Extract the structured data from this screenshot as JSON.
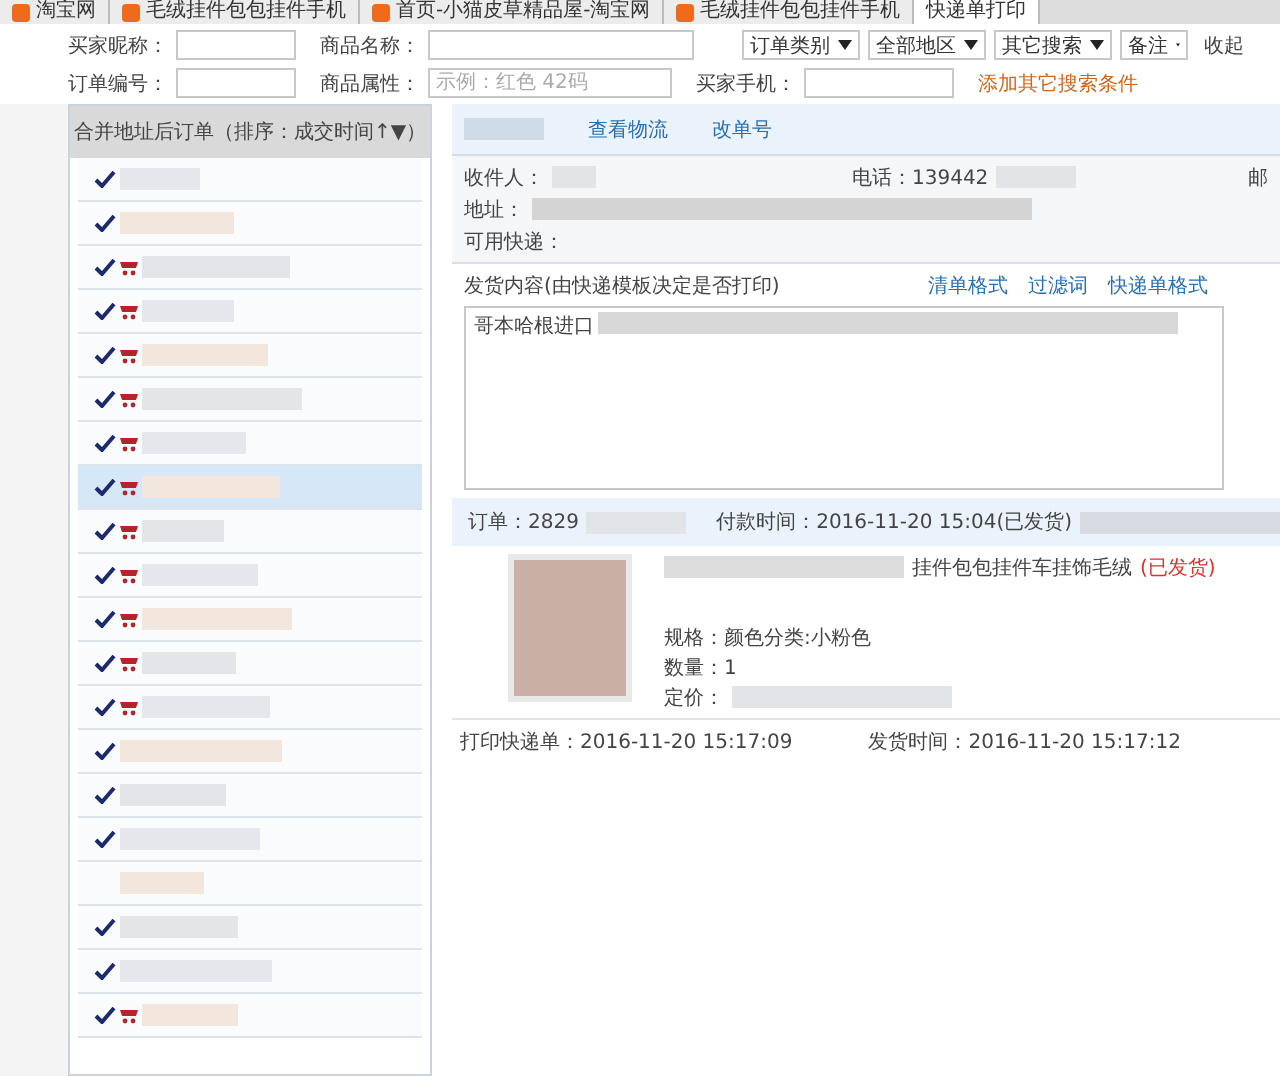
{
  "browser_tabs": [
    {
      "title": "淘宝网",
      "selected": false
    },
    {
      "title": "毛绒挂件包包挂件手机",
      "selected": false
    },
    {
      "title": "首页-小猫皮草精品屋-淘宝网",
      "selected": false
    },
    {
      "title": "毛绒挂件包包挂件手机",
      "selected": false
    },
    {
      "title": "快递单打印",
      "selected": true
    }
  ],
  "search": {
    "row1": [
      {
        "label": "买家昵称："
      },
      {
        "label": "商品名称："
      }
    ],
    "dropdowns": [
      "订单类别",
      "全部地区",
      "其它搜索",
      "备注"
    ],
    "collapse": "收起",
    "row2": [
      {
        "label": "订单编号："
      },
      {
        "label": "商品属性：",
        "placeholder": "示例：红色 42码"
      },
      {
        "label": "买家手机："
      }
    ],
    "more_link": "添加其它搜索条件"
  },
  "order_list": {
    "header": "合并地址后订单（排序：成交时间↑▼）",
    "rows": [
      {
        "checked": true,
        "cart": false,
        "selected": false
      },
      {
        "checked": true,
        "cart": false,
        "selected": false
      },
      {
        "checked": true,
        "cart": true,
        "selected": false
      },
      {
        "checked": true,
        "cart": true,
        "selected": false
      },
      {
        "checked": true,
        "cart": true,
        "selected": false
      },
      {
        "checked": true,
        "cart": true,
        "selected": false
      },
      {
        "checked": true,
        "cart": true,
        "selected": false
      },
      {
        "checked": true,
        "cart": true,
        "selected": true
      },
      {
        "checked": true,
        "cart": true,
        "selected": false
      },
      {
        "checked": true,
        "cart": true,
        "selected": false
      },
      {
        "checked": true,
        "cart": true,
        "selected": false
      },
      {
        "checked": true,
        "cart": true,
        "selected": false
      },
      {
        "checked": true,
        "cart": true,
        "selected": false
      },
      {
        "checked": true,
        "cart": false,
        "selected": false
      },
      {
        "checked": true,
        "cart": false,
        "selected": false
      },
      {
        "checked": true,
        "cart": false,
        "selected": false
      },
      {
        "checked": false,
        "cart": false,
        "selected": false
      },
      {
        "checked": true,
        "cart": false,
        "selected": false
      },
      {
        "checked": true,
        "cart": false,
        "selected": false
      },
      {
        "checked": true,
        "cart": true,
        "selected": false
      }
    ]
  },
  "detail": {
    "actions": [
      "查看物流",
      "改单号"
    ],
    "recipient_label": "收件人：",
    "phone": "电话：139442",
    "column_3": "邮",
    "address_label": "地址：",
    "courier_label": "可用快递：",
    "content_label": "发货内容(由快递模板决定是否打印)",
    "content_links": [
      "清单格式",
      "过滤词",
      "快递单格式"
    ],
    "content_value": "哥本哈根进口",
    "order_no": "订单：2829",
    "paid_time": "付款时间：2016-11-20 15:04(已发货)",
    "product_title": "挂件包包挂件车挂饰毛绒",
    "product_status": "(已发货)",
    "specs": [
      "规格：颜色分类:小粉色",
      "数量：1",
      "定价："
    ],
    "printed": "打印快递单：2016-11-20 15:17:09",
    "shipped": "发货时间：2016-11-20 15:17:12"
  }
}
